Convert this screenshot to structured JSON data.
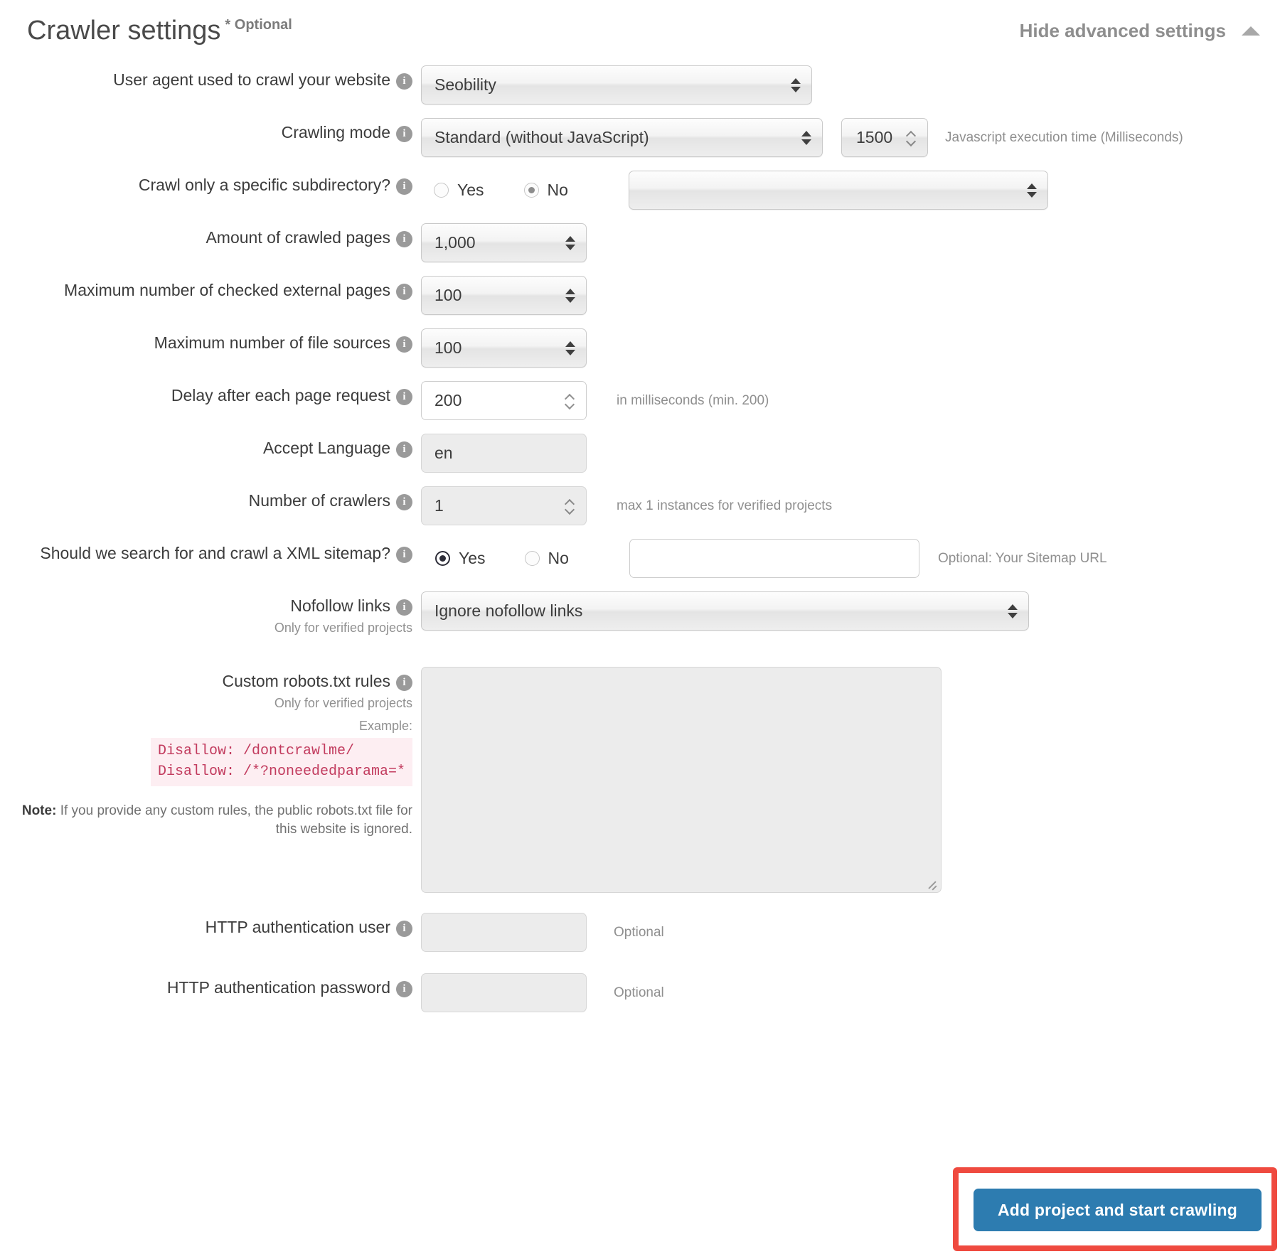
{
  "header": {
    "title": "Crawler settings",
    "optional_mark": "* Optional",
    "advanced_toggle": "Hide advanced settings",
    "caret_icon": "caret-up-icon"
  },
  "info_icon": "i",
  "rows": {
    "user_agent": {
      "label": "User agent used to crawl your website",
      "value": "Seobility"
    },
    "crawling_mode": {
      "label": "Crawling mode",
      "value": "Standard (without JavaScript)",
      "js_time_value": "1500",
      "js_time_hint": "Javascript execution time (Milliseconds)"
    },
    "subdirectory": {
      "label": "Crawl only a specific subdirectory?",
      "yes_label": "Yes",
      "no_label": "No",
      "selected": "No",
      "select_value": ""
    },
    "amount_pages": {
      "label": "Amount of crawled pages",
      "value": "1,000"
    },
    "max_external": {
      "label": "Maximum number of checked external pages",
      "value": "100"
    },
    "max_file_sources": {
      "label": "Maximum number of file sources",
      "value": "100"
    },
    "delay": {
      "label": "Delay after each page request",
      "value": "200",
      "hint": "in milliseconds (min. 200)"
    },
    "accept_language": {
      "label": "Accept Language",
      "value": "en"
    },
    "num_crawlers": {
      "label": "Number of crawlers",
      "value": "1",
      "hint": "max 1 instances for verified projects"
    },
    "xml_sitemap": {
      "label": "Should we search for and crawl a XML sitemap?",
      "yes_label": "Yes",
      "no_label": "No",
      "selected": "Yes",
      "url_value": "",
      "hint": "Optional: Your Sitemap URL"
    },
    "nofollow": {
      "label": "Nofollow links",
      "sub_label": "Only for verified projects",
      "value": "Ignore nofollow links"
    },
    "robots": {
      "label": "Custom robots.txt rules",
      "sub_label": "Only for verified projects",
      "example_label": "Example:",
      "example_code": "Disallow: /dontcrawlme/\nDisallow: /*?noneededparama=*",
      "note_prefix": "Note:",
      "note_body": " If you provide any custom rules, the public robots.txt file for this website is ignored.",
      "textarea_value": ""
    },
    "http_user": {
      "label": "HTTP authentication user",
      "value": "",
      "hint": "Optional"
    },
    "http_password": {
      "label": "HTTP authentication password",
      "value": "",
      "hint": "Optional"
    }
  },
  "footer": {
    "submit_label": "Add project and start crawling"
  },
  "colors": {
    "accent_blue": "#2d7cb0",
    "highlight_red": "#ef4a3f",
    "code_pink_bg": "#fdeef2",
    "code_pink_text": "#c23b5e",
    "muted_text": "#8f8f8f"
  }
}
